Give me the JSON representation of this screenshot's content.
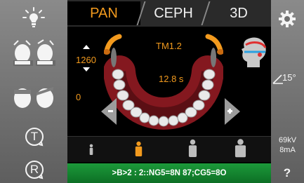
{
  "tabs": [
    {
      "label": "PAN",
      "active": true
    },
    {
      "label": "CEPH",
      "active": false
    },
    {
      "label": "3D",
      "active": false
    }
  ],
  "program": {
    "code": "TM1.2",
    "exposure_time": "12.8 s"
  },
  "height_adjust": {
    "value": "1260",
    "offset": "0"
  },
  "angle": "15°",
  "exposure": {
    "kv": "69kV",
    "ma": "8mA"
  },
  "status_message": ">B>2 : 2::NG5=8N 87;CG5=8O",
  "help_label": "?",
  "left_buttons": [
    {
      "icon": "lamp-icon"
    },
    {
      "icon": "head-tilt-icon"
    },
    {
      "icon": "head-position-icon"
    },
    {
      "icon": "t-rotate-icon",
      "label": "T"
    },
    {
      "icon": "r-rotate-icon",
      "label": "R"
    }
  ],
  "patient_sizes": [
    "child-xsmall",
    "child-small",
    "adult-medium",
    "adult-large"
  ],
  "selected_patient_size_index": 1,
  "colors": {
    "accent": "#f29a1e",
    "status_green": "#1b8f34",
    "arch_red": "#b0202a",
    "sidebar_gray": "#7a7a7a"
  }
}
